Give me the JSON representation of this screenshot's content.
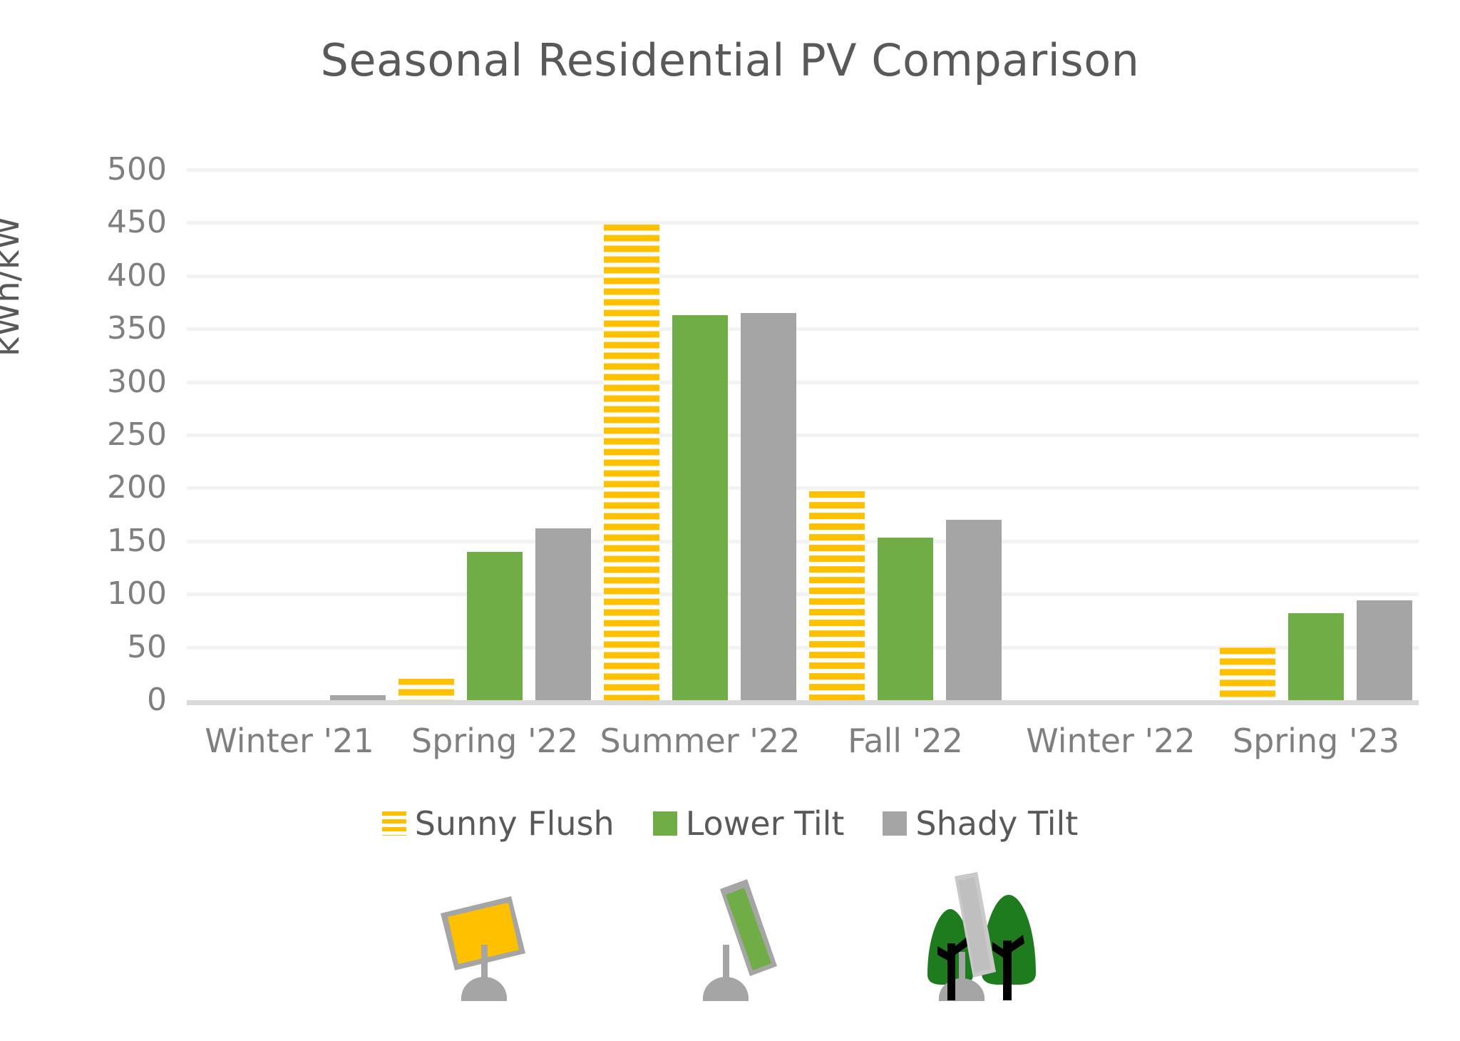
{
  "chart_data": {
    "type": "bar",
    "title": "Seasonal Residential PV Comparison",
    "xlabel": "",
    "ylabel": "kWh/kW",
    "ylim": [
      0,
      500
    ],
    "ytick_step": 50,
    "yticks": [
      "500",
      "450",
      "400",
      "350",
      "300",
      "250",
      "200",
      "150",
      "100",
      "50",
      "0"
    ],
    "grid": true,
    "legend_position": "bottom",
    "categories": [
      "Winter '21",
      "Spring '22",
      "Summer '22",
      "Fall '22",
      "Winter '22",
      "Spring '23"
    ],
    "series": [
      {
        "name": "Sunny Flush",
        "color": "#FFC000",
        "fill": "horizontal-stripes",
        "values": [
          0,
          20,
          448,
          197,
          0,
          50
        ]
      },
      {
        "name": "Lower Tilt",
        "color": "#70AD47",
        "fill": "solid",
        "values": [
          0,
          140,
          363,
          153,
          0,
          82
        ]
      },
      {
        "name": "Shady Tilt",
        "color": "#A5A5A5",
        "fill": "solid",
        "values": [
          5,
          162,
          365,
          170,
          0,
          94
        ]
      }
    ]
  },
  "colors": {
    "sunny_flush": "#FFC000",
    "lower_tilt": "#70AD47",
    "shady_tilt": "#A5A5A5",
    "gridline": "#F2F2F2",
    "axis_line": "#D9D9D9",
    "text": "#595959",
    "tick_text": "#7F7F7F",
    "tree_green": "#1E7B1E",
    "trunk_black": "#000000"
  },
  "illustrations": [
    {
      "name": "sunny-flush-panel-illustration",
      "panel_color": "#FFC000",
      "frame_color": "#A5A5A5",
      "tilt": "low"
    },
    {
      "name": "lower-tilt-panel-illustration",
      "panel_color": "#70AD47",
      "frame_color": "#A5A5A5",
      "tilt": "steep"
    },
    {
      "name": "shady-tilt-panel-illustration",
      "panel_color": "#A5A5A5",
      "frame_color": "#A5A5A5",
      "tilt": "steep",
      "shaded_by": "trees"
    }
  ]
}
